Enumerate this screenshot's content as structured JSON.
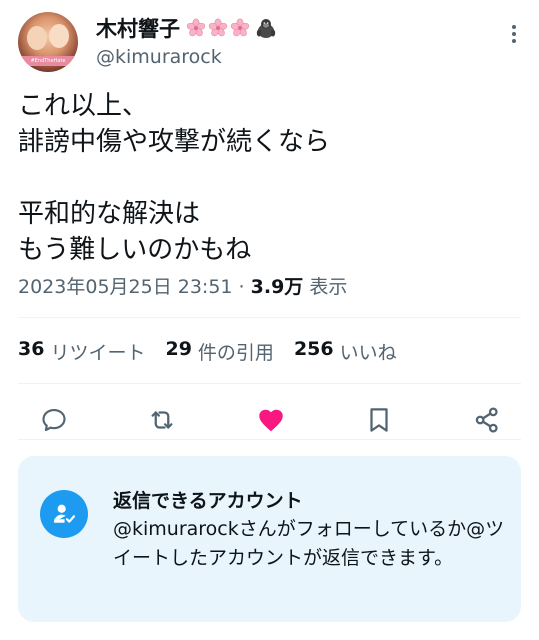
{
  "user": {
    "display_name": "木村響子",
    "handle": "@kimurarock",
    "avatar_banner": "#EndTheHate"
  },
  "tweet": {
    "text": "これ以上、\n誹謗中傷や攻撃が続くなら\n\n平和的な解決は\nもう難しいのかもね"
  },
  "meta": {
    "datetime": "2023年05月25日 23:51",
    "separator": " · ",
    "views_count": "3.9万",
    "views_label": " 表示"
  },
  "stats": {
    "retweets": {
      "count": "36",
      "label": "リツイート"
    },
    "quotes": {
      "count": "29",
      "label": "件の引用"
    },
    "likes": {
      "count": "256",
      "label": "いいね"
    }
  },
  "actions": [
    "reply-icon",
    "retweet-icon",
    "like-heart-icon",
    "bookmark-icon",
    "share-icon"
  ],
  "reply_restriction": {
    "title": "返信できるアカウント",
    "description": "@kimurarockさんがフォローしているか@ツイートしたアカウントが返信できます。"
  },
  "colors": {
    "text": "#0f1419",
    "secondary": "#536471",
    "accent": "#1d9bf0",
    "like": "#f91880",
    "reply_box_bg": "#e8f5fd"
  }
}
